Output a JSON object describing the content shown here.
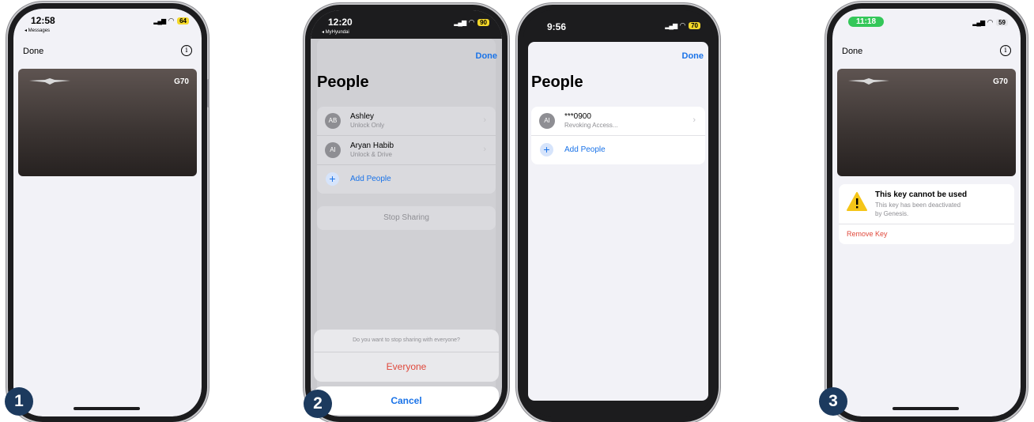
{
  "phone1": {
    "time": "12:58",
    "back": "◂ Messages",
    "battery": "64",
    "done": "Done",
    "info": "i",
    "card_model": "G70",
    "step": "1"
  },
  "phone2": {
    "time": "12:20",
    "back": "◂ MyHyundai",
    "battery": "90",
    "done": "Done",
    "title": "People",
    "people": [
      {
        "initials": "AB",
        "name": "Ashley",
        "role": "Unlock Only"
      },
      {
        "initials": "AI",
        "name": "Aryan Habib",
        "role": "Unlock & Drive"
      }
    ],
    "add_people": "Add People",
    "stop_sharing": "Stop Sharing",
    "sheet_question": "Do you want to stop sharing with everyone?",
    "sheet_everyone": "Everyone",
    "sheet_cancel": "Cancel",
    "step": "2"
  },
  "phone2b": {
    "time": "9:56",
    "battery": "70",
    "done": "Done",
    "title": "People",
    "person": {
      "initials": "AI",
      "name": "***0900",
      "role": "Revoking Access..."
    },
    "add_people": "Add People"
  },
  "phone3": {
    "time": "11:18",
    "battery": "59",
    "done": "Done",
    "info": "i",
    "card_model": "G70",
    "alert_title": "This key cannot be used",
    "alert_body_1": "This key has been deactivated",
    "alert_body_2": "by Genesis.",
    "remove_key": "Remove Key",
    "step": "3"
  },
  "colors": {
    "accent": "#1a73e8",
    "destructive": "#e0483b",
    "badge": "#1c3a5e",
    "card": "#3a3331"
  }
}
